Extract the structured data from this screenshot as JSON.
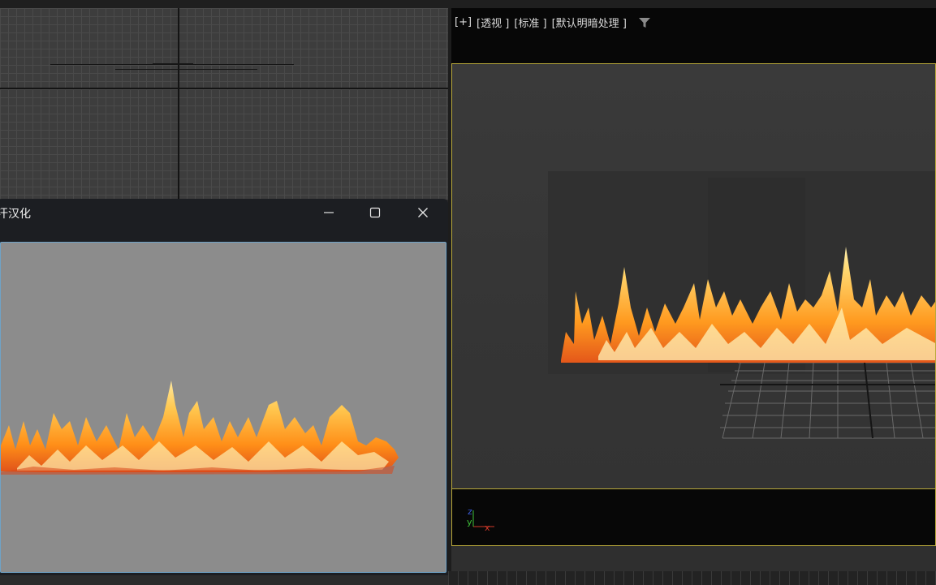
{
  "viewport_perspective": {
    "label_plus": "[+]",
    "label_view": "[透视 ]",
    "label_shading": "[标准 ]",
    "label_lighting": "[默认明暗处理 ]",
    "filter_icon": "filter-icon"
  },
  "axis_gizmo": {
    "z": "z",
    "y": "y",
    "x": "x",
    "colors": {
      "x": "#d23a2a",
      "y": "#3fc23a",
      "z": "#3a5ad6"
    }
  },
  "render_window": {
    "title": "汗汉化",
    "minimize_icon": "minimize-icon",
    "maximize_icon": "maximize-icon",
    "close_icon": "close-icon"
  },
  "colors": {
    "viewport_active_border": "#b9a93a",
    "render_frame_border": "#6fa3c7",
    "fire_core": "#ffe27a",
    "fire_mid": "#ff9a1f",
    "fire_edge": "#e4571a"
  }
}
